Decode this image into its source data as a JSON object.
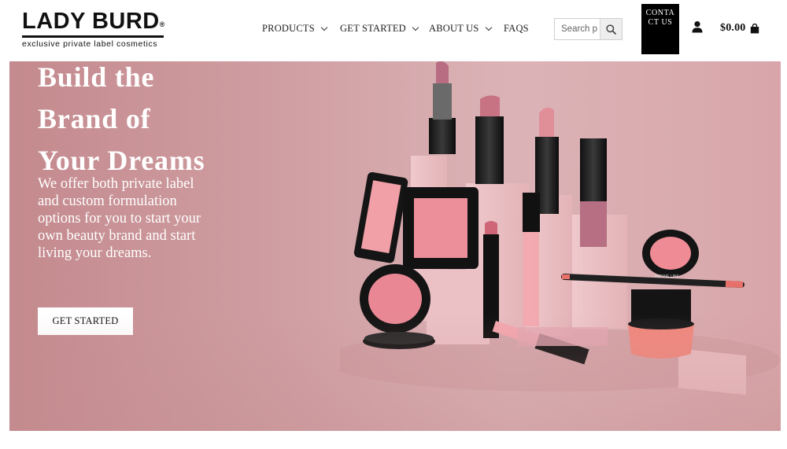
{
  "logo": {
    "title": "LADY BURD",
    "registered": "®",
    "tagline": "exclusive private label cosmetics"
  },
  "nav": {
    "items": [
      {
        "label": "PRODUCTS",
        "icon": "chevron-down-icon"
      },
      {
        "label": "GET STARTED",
        "icon": "chevron-down-icon"
      },
      {
        "label": "ABOUT US",
        "icon": "chevron-down-icon"
      },
      {
        "label": "FAQS"
      }
    ]
  },
  "search": {
    "placeholder": "Search p",
    "button_icon": "search-icon"
  },
  "contact": {
    "label": "CONTACT US"
  },
  "account": {
    "icon": "user-icon"
  },
  "cart": {
    "total": "$0.00",
    "icon": "shopping-bag-icon"
  },
  "hero": {
    "headline_lines": [
      "Build the",
      "Brand of",
      "Your Dreams"
    ],
    "subcopy": "We offer both private label and custom formulation options for you to start your own beauty brand and start living your dreams.",
    "button_label": "GET STARTED",
    "image_text": {
      "liner_label": "REFINE LINE"
    }
  },
  "colors": {
    "hero_background": "#d3a5a8",
    "accent_black": "#000000",
    "lipstick_pink": "#e08e98",
    "blush_pink": "#ec8f9a",
    "liner_coral": "#e8706a"
  }
}
